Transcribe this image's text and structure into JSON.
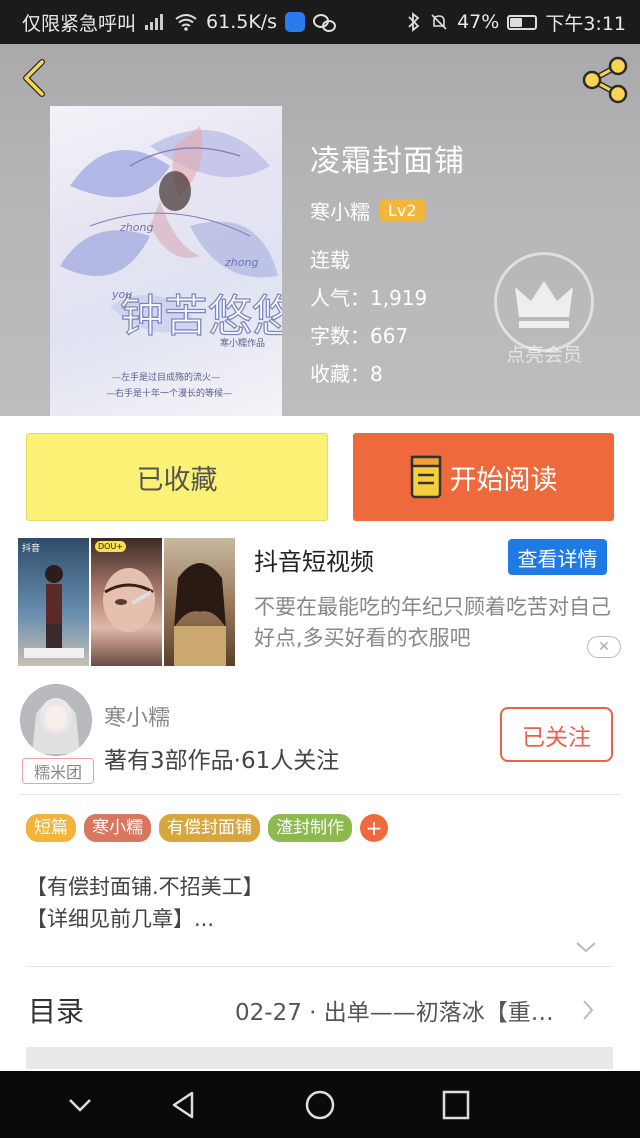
{
  "status_bar": {
    "carrier": "仅限紧急呼叫",
    "speed": "61.5K/s",
    "battery": "47%",
    "battery_level": 0.47,
    "time": "下午3:11"
  },
  "book": {
    "title": "凌霜封面铺",
    "author": "寒小糯",
    "level": "Lv2",
    "status": "连载",
    "popularity": "人气：1,919",
    "word_count": "字数：667",
    "favorites": "收藏：8"
  },
  "cover": {
    "art_title": "钟苦悠悠",
    "pinyin": "zhong",
    "pinyin2": "you",
    "subtitle1": "—左手是过目成殇的流火—",
    "subtitle2": "—右手是十年一个漫长的等候—",
    "author_stamp": "寒小糯作品"
  },
  "vip": {
    "label": "点亮会员"
  },
  "actions": {
    "favorited": "已收藏",
    "start_reading": "开始阅读"
  },
  "ad": {
    "title": "抖音短视频",
    "detail_button": "查看详情",
    "description": "不要在最能吃的年纪只顾着吃苦对自己好点,多买好看的衣服吧",
    "close": "✕",
    "thumb_logo": "抖音",
    "thumb_tag": "DOU+"
  },
  "author_section": {
    "name": "寒小糯",
    "stats": "著有3部作品·61人关注",
    "fan_badge": "糯米团",
    "follow_button": "已关注"
  },
  "tags": [
    {
      "label": "短篇",
      "color": "#f2b43b"
    },
    {
      "label": "寒小糯",
      "color": "#d9765f"
    },
    {
      "label": "有偿封面铺",
      "color": "#d7a63e"
    },
    {
      "label": "渣封制作",
      "color": "#8cba4f"
    }
  ],
  "tag_add": "+",
  "intro": {
    "line1": "【有偿封面铺.不招美工】",
    "line2": "【详细见前几章】..."
  },
  "catalog": {
    "label": "目录",
    "latest": "02-27 · 出单——初落冰【重…"
  },
  "colors": {
    "accent_orange": "#ee6a3c",
    "fav_yellow": "#fbf174",
    "ad_blue": "#1e7be6",
    "header_gray": "#b6b6b8"
  }
}
